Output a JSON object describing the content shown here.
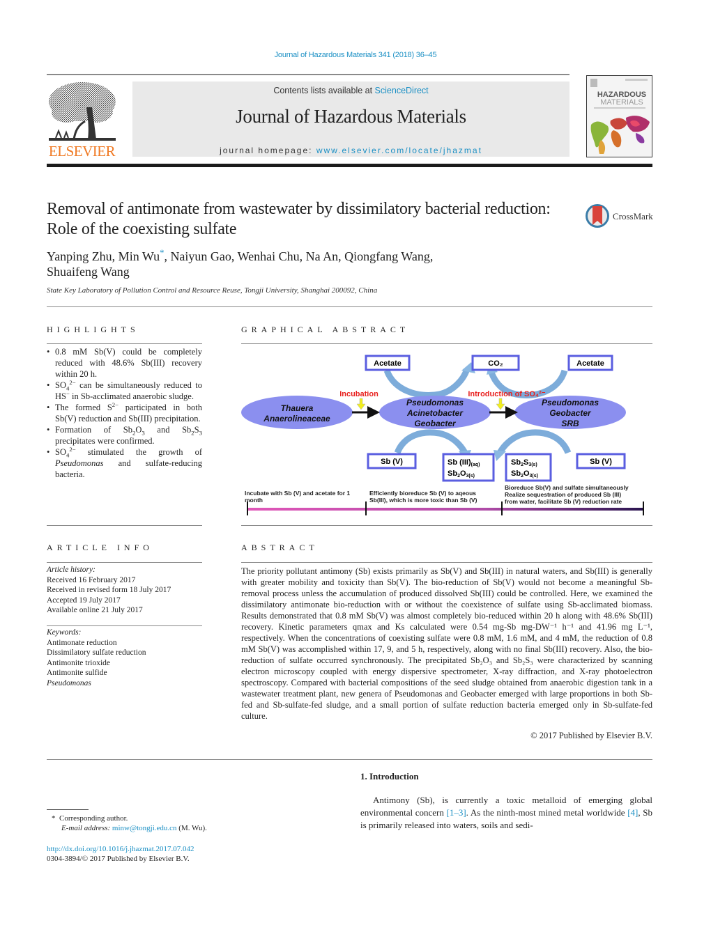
{
  "header": {
    "journal_ref": "Journal of Hazardous Materials 341 (2018) 36–45",
    "publisher_logo_text": "ELSEVIER",
    "contents_prefix": "Contents lists available at ",
    "contents_link": "ScienceDirect",
    "journal_title": "Journal of Hazardous Materials",
    "homepage_prefix": "journal homepage: ",
    "homepage_link": "www.elsevier.com/locate/jhazmat",
    "cover_title_line1": "HAZARDOUS",
    "cover_title_line2": "MATERIALS",
    "brand_color": "#f07a24",
    "link_color": "#1a8fc4"
  },
  "article": {
    "title": "Removal of antimonate from wastewater by dissimilatory bacterial reduction: Role of the coexisting sulfate",
    "crossmark_label": "CrossMark",
    "authors_part1": "Yanping Zhu, Min Wu",
    "author_mark": "*",
    "authors_part2": ", Naiyun Gao, Wenhai Chu, Na An, Qiongfang Wang,",
    "authors_line2": "Shuaifeng Wang",
    "affiliation": "State Key Laboratory of Pollution Control and Resource Reuse, Tongji University, Shanghai 200092, China"
  },
  "highlights": {
    "heading": "HIGHLIGHTS",
    "items": [
      "0.8 mM Sb(V) could be completely reduced with 48.6% Sb(III) recovery within 20 h.",
      "SO₄²⁻ can be simultaneously reduced to HS⁻ in Sb-acclimated anaerobic sludge.",
      "The formed S²⁻ participated in both Sb(V) reduction and Sb(III) precipitation.",
      "Formation of Sb₂O₃ and Sb₂S₃ precipitates were confirmed.",
      "SO₄²⁻ stimulated the growth of Pseudomonas and sulfate-reducing bacteria."
    ]
  },
  "graphical_abstract": {
    "heading": "GRAPHICAL ABSTRACT",
    "top_boxes": [
      "Acetate",
      "CO₂",
      "Acetate"
    ],
    "ellipses": [
      [
        "Thauera",
        "Anaerolineaceae"
      ],
      [
        "Pseudomonas",
        "Acinetobacter",
        "Geobacter"
      ],
      [
        "Pseudomonas",
        "Geobacter",
        "SRB"
      ]
    ],
    "step_labels": [
      "Incubation",
      "Introduction of SO₄²⁻"
    ],
    "bottom_boxes": [
      [
        "Sb (V)"
      ],
      [
        "Sb (III)(aq)",
        "Sb₂O₃(s)"
      ],
      [
        "Sb₂S₃(s)",
        "Sb₂O₃(s)"
      ],
      [
        "Sb (V)"
      ]
    ],
    "timeline_labels": [
      [
        "Incubate with Sb (V)  and acetate for 1",
        "month"
      ],
      [
        "Efficiently bioreduce Sb (V) to aqeous",
        "Sb(III), which is more toxic than Sb (V)"
      ],
      [
        "Bioreduce Sb(V) and sulfate simultaneously",
        "Realize sequestration of  produced Sb (III)",
        "from water, facilitate Sb (V) reduction rate"
      ]
    ],
    "colors": {
      "ellipse": "#8b8fef",
      "box_border": "#5a5ee0",
      "arrow": "#6fa3d6",
      "label_red": "#e8201e",
      "down_arrow": "#f2ef1e",
      "timeline_start": "#e056b8",
      "timeline_end": "#2a1550"
    }
  },
  "article_info": {
    "heading": "ARTICLE INFO",
    "history_label": "Article history:",
    "history": [
      "Received 16 February 2017",
      "Received in revised form 18 July 2017",
      "Accepted 19 July 2017",
      "Available online 21 July 2017"
    ],
    "keywords_label": "Keywords:",
    "keywords": [
      "Antimonate reduction",
      "Dissimilatory sulfate reduction",
      "Antimonite trioxide",
      "Antimonite sulfide",
      "Pseudomonas"
    ]
  },
  "abstract": {
    "heading": "ABSTRACT",
    "text": "The priority pollutant antimony (Sb) exists primarily as Sb(V) and Sb(III) in natural waters, and Sb(III) is generally with greater mobility and toxicity than Sb(V). The bio-reduction of Sb(V) would not become a meaningful Sb-removal process unless the accumulation of produced dissolved Sb(III) could be controlled. Here, we examined the dissimilatory antimonate bio-reduction with or without the coexistence of sulfate using Sb-acclimated biomass. Results demonstrated that 0.8 mM Sb(V) was almost completely bio-reduced within 20 h along with 48.6% Sb(III) recovery. Kinetic parameters qmax and Ks calculated were 0.54 mg-Sb mg-DW⁻¹ h⁻¹ and 41.96 mg L⁻¹, respectively. When the concentrations of coexisting sulfate were 0.8 mM, 1.6 mM, and 4 mM, the reduction of 0.8 mM Sb(V) was accomplished within 17, 9, and 5 h, respectively, along with no final Sb(III) recovery. Also, the bio-reduction of sulfate occurred synchronously. The precipitated Sb₂O₃ and Sb₂S₃ were characterized by scanning electron microscopy coupled with energy dispersive spectrometer, X-ray diffraction, and X-ray photoelectron spectroscopy. Compared with bacterial compositions of the seed sludge obtained from anaerobic digestion tank in a wastewater treatment plant, new genera of Pseudomonas and Geobacter emerged with large proportions in both Sb-fed and Sb-sulfate-fed sludge, and a small portion of sulfate reduction bacteria emerged only in Sb-sulfate-fed culture.",
    "copyright": "© 2017 Published by Elsevier B.V."
  },
  "introduction": {
    "heading": "1.  Introduction",
    "text_part1": "Antimony (Sb), is currently a toxic metalloid of emerging global environmental concern ",
    "ref1": "[1–3]",
    "text_part2": ". As the ninth-most mined metal worldwide ",
    "ref2": "[4]",
    "text_part3": ", Sb is primarily released into waters, soils and sedi-"
  },
  "footnote": {
    "mark": "*",
    "corresponding": "Corresponding author.",
    "email_label": "E-mail address: ",
    "email": "minw@tongji.edu.cn",
    "email_suffix": " (M. Wu).",
    "doi": "http://dx.doi.org/10.1016/j.jhazmat.2017.07.042",
    "issn_line": "0304-3894/© 2017 Published by Elsevier B.V."
  }
}
